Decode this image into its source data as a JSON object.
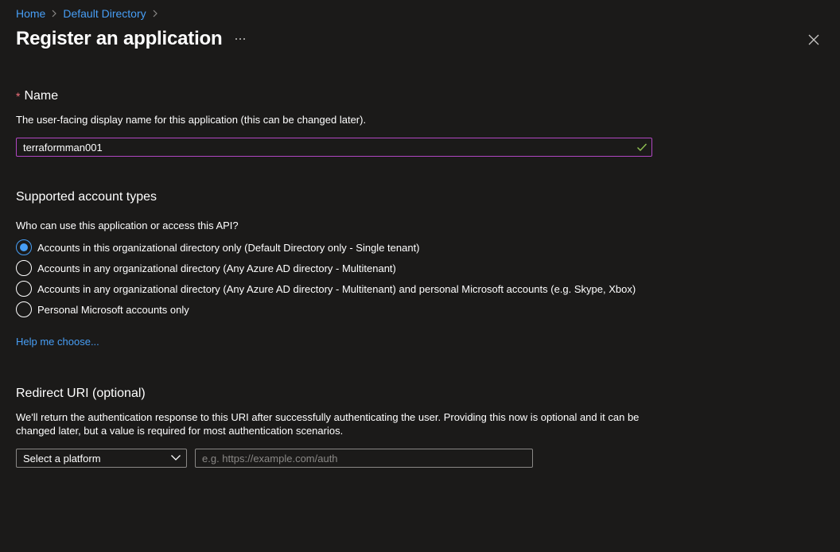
{
  "breadcrumb": {
    "items": [
      "Home",
      "Default Directory"
    ]
  },
  "header": {
    "title": "Register an application",
    "more_label": "···"
  },
  "name_section": {
    "required_mark": "*",
    "label": "Name",
    "description": "The user-facing display name for this application (this can be changed later).",
    "value": "terraformman001"
  },
  "account_types": {
    "heading": "Supported account types",
    "question": "Who can use this application or access this API?",
    "options": [
      {
        "label": "Accounts in this organizational directory only (Default Directory only - Single tenant)",
        "selected": true
      },
      {
        "label": "Accounts in any organizational directory (Any Azure AD directory - Multitenant)",
        "selected": false
      },
      {
        "label": "Accounts in any organizational directory (Any Azure AD directory - Multitenant) and personal Microsoft accounts (e.g. Skype, Xbox)",
        "selected": false
      },
      {
        "label": "Personal Microsoft accounts only",
        "selected": false
      }
    ],
    "help_link": "Help me choose..."
  },
  "redirect_uri": {
    "heading": "Redirect URI (optional)",
    "description_line1": "We'll return the authentication response to this URI after successfully authenticating the user. Providing this now is optional and it can be",
    "description_line2": "changed later, but a value is required for most authentication scenarios.",
    "platform_selected": "Select a platform",
    "uri_placeholder": "e.g. https://example.com/auth"
  },
  "colors": {
    "background": "#1b1a19",
    "link": "#479ef5",
    "focus_border": "#b146c2",
    "success_check": "#92c353",
    "required": "#f1707b"
  }
}
